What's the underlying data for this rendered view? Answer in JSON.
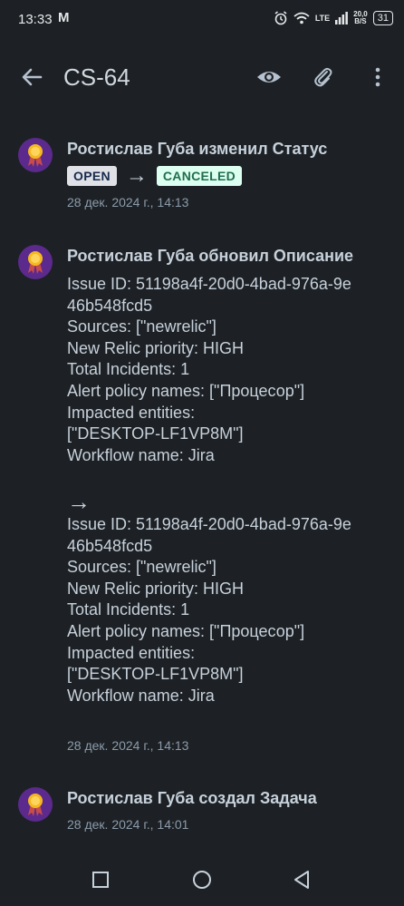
{
  "status_bar": {
    "time": "13:33",
    "mail_glyph": "M",
    "network": "LTE",
    "speed_value": "20,0",
    "speed_unit": "B/S",
    "battery": "31"
  },
  "app_bar": {
    "title": "CS-64",
    "icons": [
      "back-arrow-icon",
      "eye-icon",
      "paperclip-icon",
      "more-vert-icon"
    ]
  },
  "history": [
    {
      "header": "Ростислав Губа изменил Статус",
      "from_status": "OPEN",
      "arrow": "→",
      "to_status": "CANCELED",
      "date": "28 дек. 2024 г., 14:13"
    },
    {
      "header": "Ростислав Губа обновил Описание",
      "old_description": "Issue ID: 51198a4f-20d0-4bad-976a-9e\n46b548fcd5\nSources: [\"newrelic\"]\nNew Relic priority: HIGH\nTotal Incidents: 1\nAlert policy names: [\"Процесор\"]\nImpacted entities:\n[\"DESKTOP-LF1VP8M\"]\nWorkflow name: Jira",
      "arrow": "→",
      "new_description": "Issue ID: 51198a4f-20d0-4bad-976a-9e\n46b548fcd5\nSources: [\"newrelic\"]\nNew Relic priority: HIGH\nTotal Incidents: 1\nAlert policy names: [\"Процесор\"]\nImpacted entities:\n[\"DESKTOP-LF1VP8M\"]\nWorkflow name: Jira",
      "date": "28 дек. 2024 г., 14:13"
    },
    {
      "header": "Ростислав Губа создал Задача",
      "date": "28 дек. 2024 г., 14:01"
    }
  ],
  "nav_bar": {
    "icons": [
      "recents-square-icon",
      "home-circle-icon",
      "back-triangle-icon"
    ]
  },
  "colors": {
    "background": "#1d2125",
    "avatar": "#5b2a8c",
    "open_lozenge": "#dfe1e6",
    "canceled_lozenge": "#dcfff1"
  }
}
